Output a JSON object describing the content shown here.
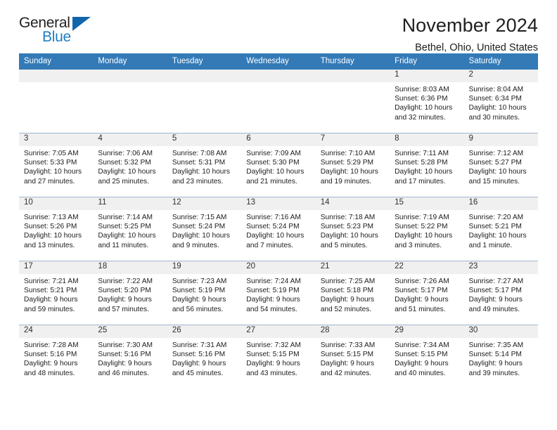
{
  "brand": {
    "name_top": "General",
    "name_bottom": "Blue",
    "accent_color": "#1166ab",
    "blue_text_color": "#1f7ec4"
  },
  "header": {
    "title": "November 2024",
    "subtitle": "Bethel, Ohio, United States",
    "header_bg_color": "#337ab7",
    "daynum_band_color": "#f0f0f0",
    "row_divider_color": "#9fb6cc"
  },
  "weekdays": [
    "Sunday",
    "Monday",
    "Tuesday",
    "Wednesday",
    "Thursday",
    "Friday",
    "Saturday"
  ],
  "labels": {
    "sunrise_prefix": "Sunrise: ",
    "sunset_prefix": "Sunset: ",
    "daylight_prefix": "Daylight: "
  },
  "weeks": [
    [
      {
        "day": "",
        "empty": true
      },
      {
        "day": "",
        "empty": true
      },
      {
        "day": "",
        "empty": true
      },
      {
        "day": "",
        "empty": true
      },
      {
        "day": "",
        "empty": true
      },
      {
        "day": "1",
        "sunrise": "Sunrise: 8:03 AM",
        "sunset": "Sunset: 6:36 PM",
        "daylight": "Daylight: 10 hours and 32 minutes."
      },
      {
        "day": "2",
        "sunrise": "Sunrise: 8:04 AM",
        "sunset": "Sunset: 6:34 PM",
        "daylight": "Daylight: 10 hours and 30 minutes."
      }
    ],
    [
      {
        "day": "3",
        "sunrise": "Sunrise: 7:05 AM",
        "sunset": "Sunset: 5:33 PM",
        "daylight": "Daylight: 10 hours and 27 minutes."
      },
      {
        "day": "4",
        "sunrise": "Sunrise: 7:06 AM",
        "sunset": "Sunset: 5:32 PM",
        "daylight": "Daylight: 10 hours and 25 minutes."
      },
      {
        "day": "5",
        "sunrise": "Sunrise: 7:08 AM",
        "sunset": "Sunset: 5:31 PM",
        "daylight": "Daylight: 10 hours and 23 minutes."
      },
      {
        "day": "6",
        "sunrise": "Sunrise: 7:09 AM",
        "sunset": "Sunset: 5:30 PM",
        "daylight": "Daylight: 10 hours and 21 minutes."
      },
      {
        "day": "7",
        "sunrise": "Sunrise: 7:10 AM",
        "sunset": "Sunset: 5:29 PM",
        "daylight": "Daylight: 10 hours and 19 minutes."
      },
      {
        "day": "8",
        "sunrise": "Sunrise: 7:11 AM",
        "sunset": "Sunset: 5:28 PM",
        "daylight": "Daylight: 10 hours and 17 minutes."
      },
      {
        "day": "9",
        "sunrise": "Sunrise: 7:12 AM",
        "sunset": "Sunset: 5:27 PM",
        "daylight": "Daylight: 10 hours and 15 minutes."
      }
    ],
    [
      {
        "day": "10",
        "sunrise": "Sunrise: 7:13 AM",
        "sunset": "Sunset: 5:26 PM",
        "daylight": "Daylight: 10 hours and 13 minutes."
      },
      {
        "day": "11",
        "sunrise": "Sunrise: 7:14 AM",
        "sunset": "Sunset: 5:25 PM",
        "daylight": "Daylight: 10 hours and 11 minutes."
      },
      {
        "day": "12",
        "sunrise": "Sunrise: 7:15 AM",
        "sunset": "Sunset: 5:24 PM",
        "daylight": "Daylight: 10 hours and 9 minutes."
      },
      {
        "day": "13",
        "sunrise": "Sunrise: 7:16 AM",
        "sunset": "Sunset: 5:24 PM",
        "daylight": "Daylight: 10 hours and 7 minutes."
      },
      {
        "day": "14",
        "sunrise": "Sunrise: 7:18 AM",
        "sunset": "Sunset: 5:23 PM",
        "daylight": "Daylight: 10 hours and 5 minutes."
      },
      {
        "day": "15",
        "sunrise": "Sunrise: 7:19 AM",
        "sunset": "Sunset: 5:22 PM",
        "daylight": "Daylight: 10 hours and 3 minutes."
      },
      {
        "day": "16",
        "sunrise": "Sunrise: 7:20 AM",
        "sunset": "Sunset: 5:21 PM",
        "daylight": "Daylight: 10 hours and 1 minute."
      }
    ],
    [
      {
        "day": "17",
        "sunrise": "Sunrise: 7:21 AM",
        "sunset": "Sunset: 5:21 PM",
        "daylight": "Daylight: 9 hours and 59 minutes."
      },
      {
        "day": "18",
        "sunrise": "Sunrise: 7:22 AM",
        "sunset": "Sunset: 5:20 PM",
        "daylight": "Daylight: 9 hours and 57 minutes."
      },
      {
        "day": "19",
        "sunrise": "Sunrise: 7:23 AM",
        "sunset": "Sunset: 5:19 PM",
        "daylight": "Daylight: 9 hours and 56 minutes."
      },
      {
        "day": "20",
        "sunrise": "Sunrise: 7:24 AM",
        "sunset": "Sunset: 5:19 PM",
        "daylight": "Daylight: 9 hours and 54 minutes."
      },
      {
        "day": "21",
        "sunrise": "Sunrise: 7:25 AM",
        "sunset": "Sunset: 5:18 PM",
        "daylight": "Daylight: 9 hours and 52 minutes."
      },
      {
        "day": "22",
        "sunrise": "Sunrise: 7:26 AM",
        "sunset": "Sunset: 5:17 PM",
        "daylight": "Daylight: 9 hours and 51 minutes."
      },
      {
        "day": "23",
        "sunrise": "Sunrise: 7:27 AM",
        "sunset": "Sunset: 5:17 PM",
        "daylight": "Daylight: 9 hours and 49 minutes."
      }
    ],
    [
      {
        "day": "24",
        "sunrise": "Sunrise: 7:28 AM",
        "sunset": "Sunset: 5:16 PM",
        "daylight": "Daylight: 9 hours and 48 minutes."
      },
      {
        "day": "25",
        "sunrise": "Sunrise: 7:30 AM",
        "sunset": "Sunset: 5:16 PM",
        "daylight": "Daylight: 9 hours and 46 minutes."
      },
      {
        "day": "26",
        "sunrise": "Sunrise: 7:31 AM",
        "sunset": "Sunset: 5:16 PM",
        "daylight": "Daylight: 9 hours and 45 minutes."
      },
      {
        "day": "27",
        "sunrise": "Sunrise: 7:32 AM",
        "sunset": "Sunset: 5:15 PM",
        "daylight": "Daylight: 9 hours and 43 minutes."
      },
      {
        "day": "28",
        "sunrise": "Sunrise: 7:33 AM",
        "sunset": "Sunset: 5:15 PM",
        "daylight": "Daylight: 9 hours and 42 minutes."
      },
      {
        "day": "29",
        "sunrise": "Sunrise: 7:34 AM",
        "sunset": "Sunset: 5:15 PM",
        "daylight": "Daylight: 9 hours and 40 minutes."
      },
      {
        "day": "30",
        "sunrise": "Sunrise: 7:35 AM",
        "sunset": "Sunset: 5:14 PM",
        "daylight": "Daylight: 9 hours and 39 minutes."
      }
    ]
  ]
}
